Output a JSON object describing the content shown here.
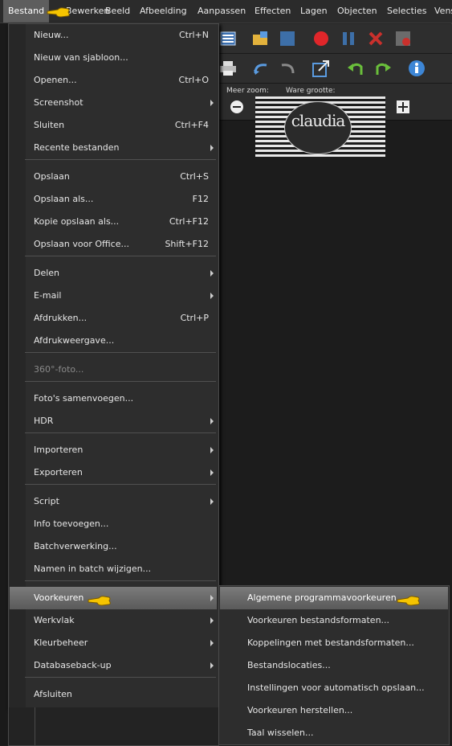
{
  "menubar": [
    "Bestand",
    "Bewerken",
    "Beeld",
    "Afbeelding",
    "Aanpassen",
    "Effecten",
    "Lagen",
    "Objecten",
    "Selecties",
    "Venster"
  ],
  "zoom": {
    "more_label": "Meer zoom:",
    "actual_label": "Ware grootte:"
  },
  "logo": {
    "text": "claudia"
  },
  "file_menu": [
    {
      "label": "Nieuw...",
      "shortcut": "Ctrl+N"
    },
    {
      "label": "Nieuw van sjabloon..."
    },
    {
      "label": "Openen...",
      "shortcut": "Ctrl+O"
    },
    {
      "label": "Screenshot",
      "submenu": true
    },
    {
      "label": "Sluiten",
      "shortcut": "Ctrl+F4"
    },
    {
      "label": "Recente bestanden",
      "submenu": true
    },
    {
      "label": "Opslaan",
      "shortcut": "Ctrl+S"
    },
    {
      "label": "Opslaan als...",
      "shortcut": "F12"
    },
    {
      "label": "Kopie opslaan als...",
      "shortcut": "Ctrl+F12"
    },
    {
      "label": "Opslaan voor Office...",
      "shortcut": "Shift+F12"
    },
    {
      "label": "Delen",
      "submenu": true
    },
    {
      "label": "E-mail",
      "submenu": true
    },
    {
      "label": "Afdrukken...",
      "shortcut": "Ctrl+P"
    },
    {
      "label": "Afdrukweergave..."
    },
    {
      "label": "360°-foto...",
      "disabled": true
    },
    {
      "label": "Foto's samenvoegen..."
    },
    {
      "label": "HDR",
      "submenu": true
    },
    {
      "label": "Importeren",
      "submenu": true
    },
    {
      "label": "Exporteren",
      "submenu": true
    },
    {
      "label": "Script",
      "submenu": true
    },
    {
      "label": "Info toevoegen..."
    },
    {
      "label": "Batchverwerking..."
    },
    {
      "label": "Namen in batch wijzigen..."
    },
    {
      "label": "Voorkeuren",
      "submenu": true,
      "highlighted": true
    },
    {
      "label": "Werkvlak",
      "submenu": true
    },
    {
      "label": "Kleurbeheer",
      "submenu": true
    },
    {
      "label": "Databaseback-up",
      "submenu": true
    },
    {
      "label": "Afsluiten"
    }
  ],
  "prefs_submenu": [
    {
      "label": "Algemene programmavoorkeuren...",
      "highlighted": true
    },
    {
      "label": "Voorkeuren bestandsformaten..."
    },
    {
      "label": "Koppelingen met bestandsformaten..."
    },
    {
      "label": "Bestandslocaties..."
    },
    {
      "label": "Instellingen voor automatisch opslaan..."
    },
    {
      "label": "Voorkeuren herstellen..."
    },
    {
      "label": "Taal wisselen..."
    }
  ],
  "colors": {
    "menu_bg": "#2d2d2d",
    "highlight": "#6a6a6a",
    "pointer": "#f5c400"
  }
}
